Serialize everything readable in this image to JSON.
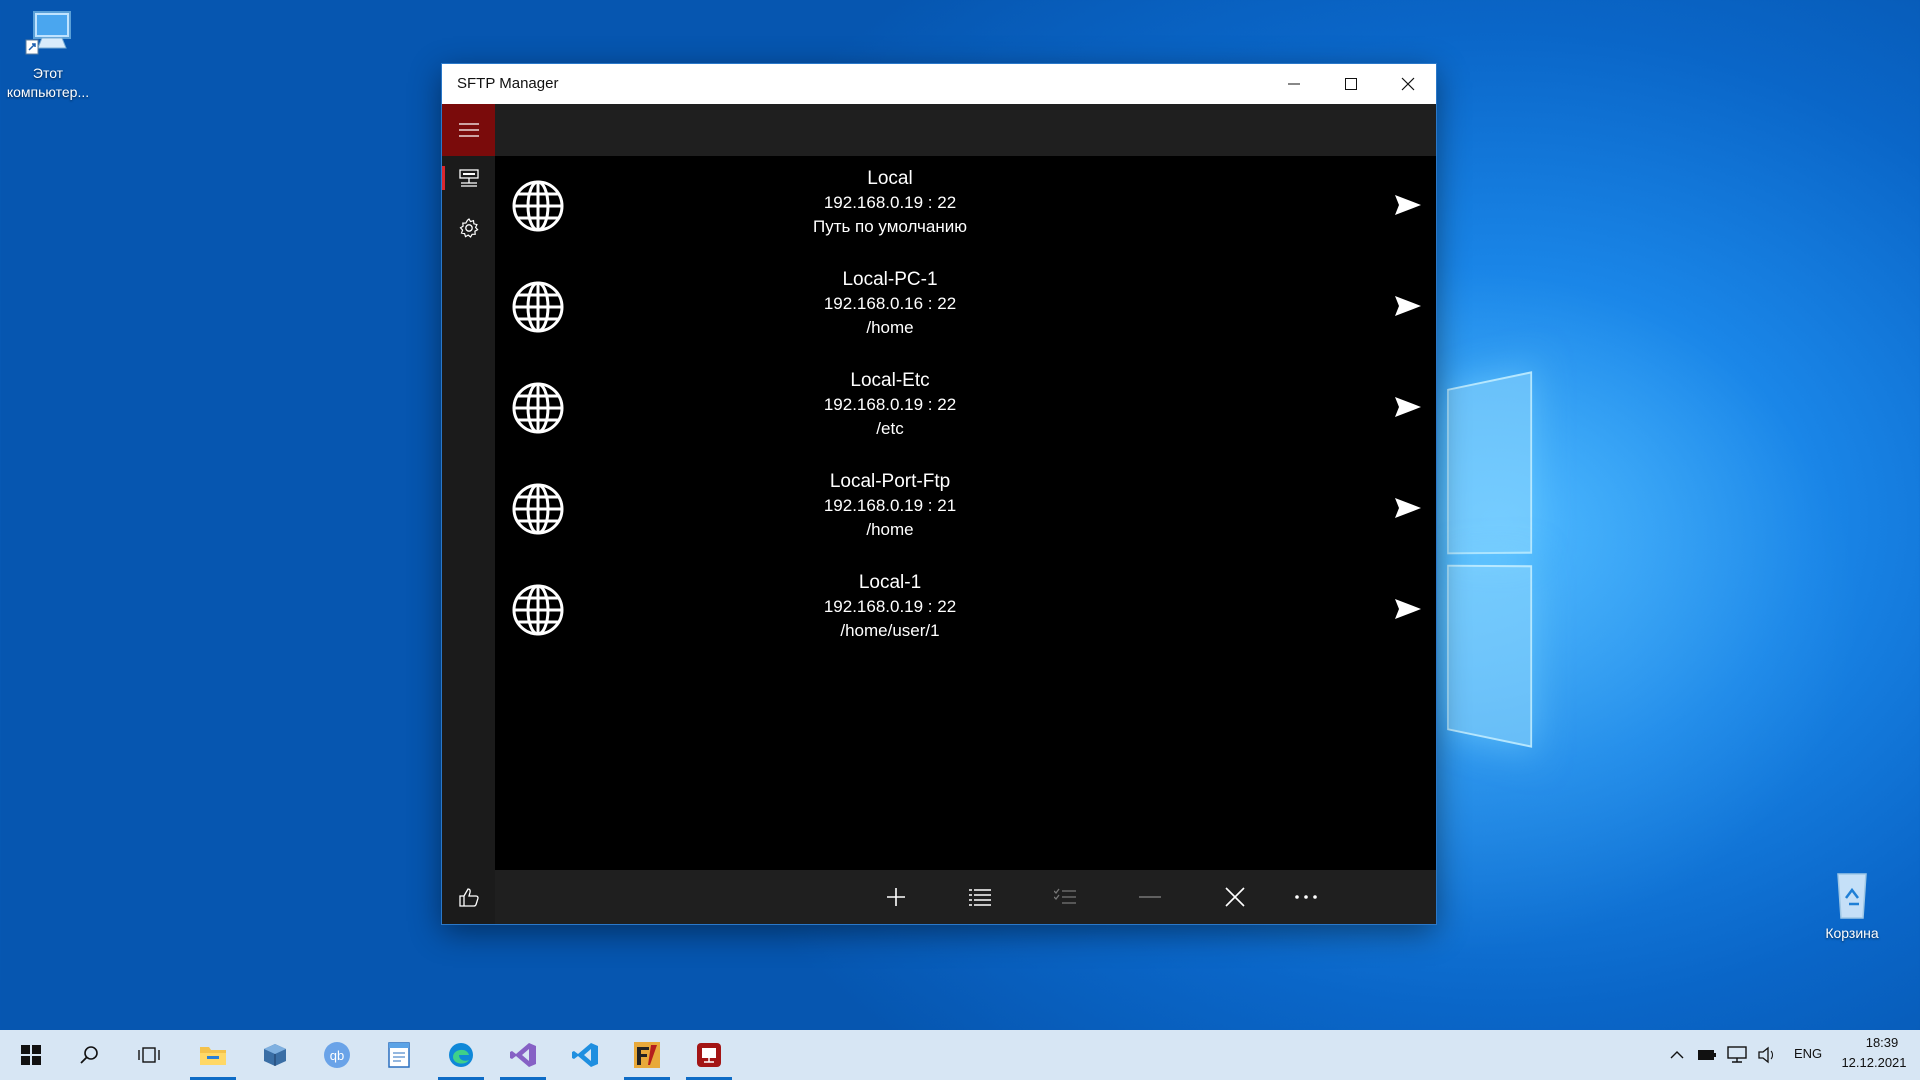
{
  "desktop": {
    "icons": [
      {
        "label": "Этот\nкомпьютер..."
      },
      {
        "label": "Корзина"
      }
    ]
  },
  "window": {
    "title": "SFTP Manager",
    "caption_buttons": [
      "minimize-icon",
      "maximize-icon",
      "close-icon"
    ]
  },
  "sidebar": {
    "nav": [
      {
        "icon": "servers-icon",
        "selected": true
      },
      {
        "icon": "gear-icon",
        "selected": false
      }
    ],
    "footer_icon": "thumbs-up-icon"
  },
  "connections": [
    {
      "name": "Local",
      "address": "192.168.0.19 : 22",
      "path": "Путь по умолчанию"
    },
    {
      "name": "Local-PC-1",
      "address": "192.168.0.16 : 22",
      "path": "/home"
    },
    {
      "name": "Local-Etc",
      "address": "192.168.0.19 : 22",
      "path": "/etc"
    },
    {
      "name": "Local-Port-Ftp",
      "address": "192.168.0.19 : 21",
      "path": "/home"
    },
    {
      "name": "Local-1",
      "address": "192.168.0.19 : 22",
      "path": "/home/user/1"
    }
  ],
  "commandbar": {
    "buttons": [
      "add-icon",
      "list-icon",
      "checklist-icon",
      "remove-icon",
      "cancel-icon",
      "more-icon"
    ]
  },
  "taskbar": {
    "apps": [
      "start-icon",
      "search-icon",
      "task-view-icon",
      "file-explorer-icon",
      "virtualbox-icon",
      "qbittorrent-icon",
      "notepad-icon",
      "edge-icon",
      "visual-studio-icon",
      "vscode-icon",
      "filezilla-icon",
      "sftp-manager-icon"
    ],
    "language": "ENG",
    "time": "18:39",
    "date": "12.12.2021"
  },
  "colors": {
    "accent": "#7a0b0b",
    "indicator": "#d9272e",
    "taskbar": "#d7e6f4"
  }
}
